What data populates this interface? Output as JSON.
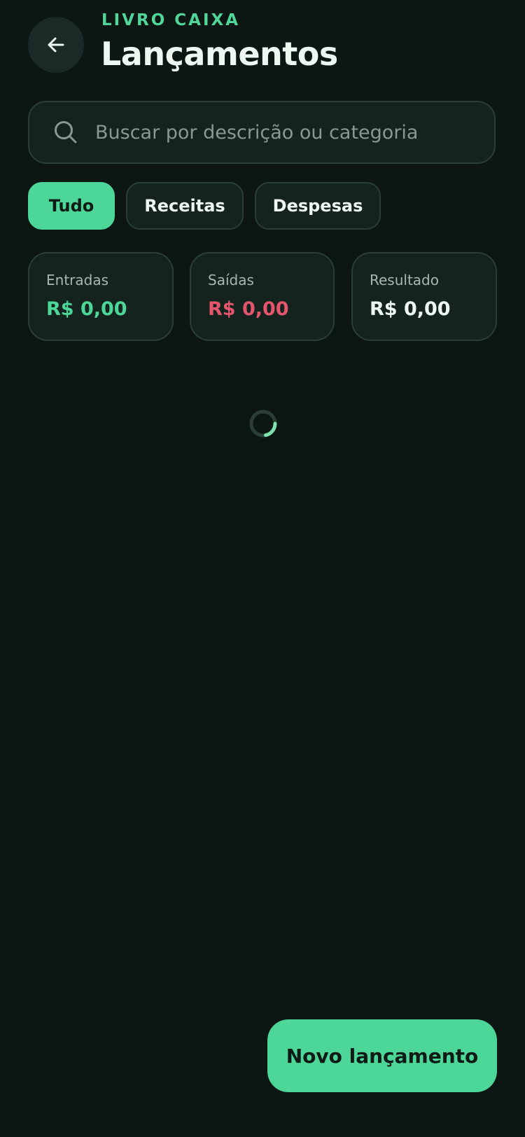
{
  "header": {
    "eyebrow": "LIVRO CAIXA",
    "title": "Lançamentos",
    "back_icon": "arrow-left-icon"
  },
  "search": {
    "placeholder": "Buscar por descrição ou categoria",
    "value": "",
    "icon": "search-icon"
  },
  "filters": {
    "active": "Tudo",
    "items": [
      {
        "label": "Tudo"
      },
      {
        "label": "Receitas"
      },
      {
        "label": "Despesas"
      }
    ]
  },
  "summary": {
    "cards": [
      {
        "label": "Entradas",
        "value": "R$ 0,00",
        "color": "#4cd698"
      },
      {
        "label": "Saídas",
        "value": "R$ 0,00",
        "color": "#e5566c"
      },
      {
        "label": "Resultado",
        "value": "R$ 0,00",
        "color": "#eef6f2"
      }
    ]
  },
  "loading": {
    "icon": "loading-spinner-icon"
  },
  "fab": {
    "label": "Novo lançamento"
  },
  "colors": {
    "background": "#0c1714",
    "surface": "#15231f",
    "border": "#2a3d37",
    "accent": "#4cd698",
    "negative": "#e5566c"
  }
}
